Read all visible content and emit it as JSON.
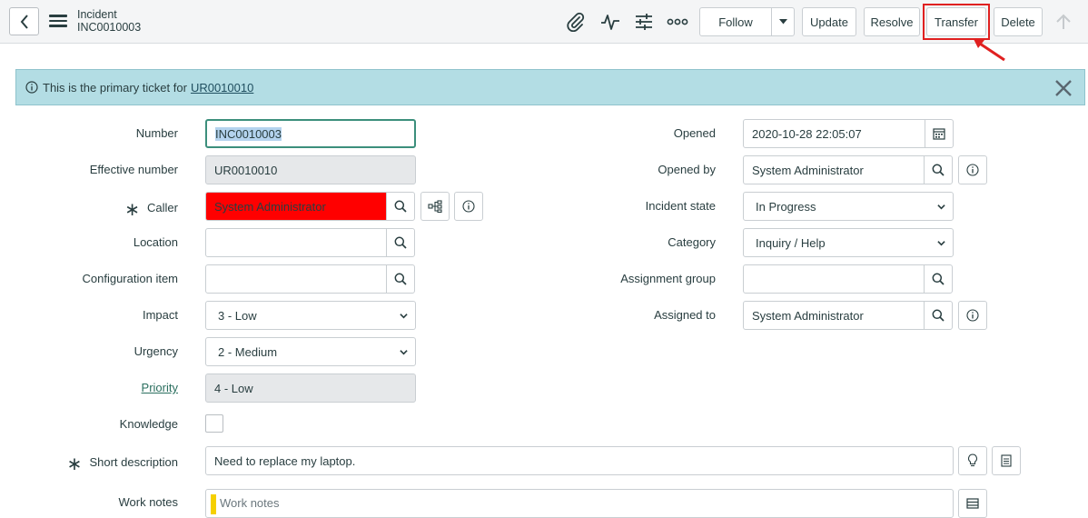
{
  "header": {
    "record_type": "Incident",
    "record_number": "INC0010003",
    "follow_label": "Follow",
    "update_label": "Update",
    "resolve_label": "Resolve",
    "transfer_label": "Transfer",
    "delete_label": "Delete"
  },
  "banner": {
    "text": "This is the primary ticket for",
    "link_text": "UR0010010"
  },
  "form": {
    "left": {
      "number_label": "Number",
      "number_value": "INC0010003",
      "effective_label": "Effective number",
      "effective_value": "UR0010010",
      "caller_label": "Caller",
      "caller_value": "System Administrator",
      "location_label": "Location",
      "location_value": "",
      "ci_label": "Configuration item",
      "ci_value": "",
      "impact_label": "Impact",
      "impact_value": "3 - Low",
      "urgency_label": "Urgency",
      "urgency_value": "2 - Medium",
      "priority_label": "Priority",
      "priority_value": "4 - Low",
      "knowledge_label": "Knowledge",
      "knowledge_checked": false
    },
    "right": {
      "opened_label": "Opened",
      "opened_value": "2020-10-28 22:05:07",
      "opened_by_label": "Opened by",
      "opened_by_value": "System Administrator",
      "state_label": "Incident state",
      "state_value": "In Progress",
      "category_label": "Category",
      "category_value": "Inquiry / Help",
      "group_label": "Assignment group",
      "group_value": "",
      "assigned_label": "Assigned to",
      "assigned_value": "System Administrator"
    },
    "short_desc_label": "Short description",
    "short_desc_value": "Need to replace my laptop.",
    "work_notes_label": "Work notes",
    "work_notes_placeholder": "Work notes"
  },
  "colors": {
    "banner_bg": "#b3dde4",
    "caller_highlight": "#ff0000",
    "annotation": "#e02020",
    "focus_border": "#3c8f7c"
  }
}
